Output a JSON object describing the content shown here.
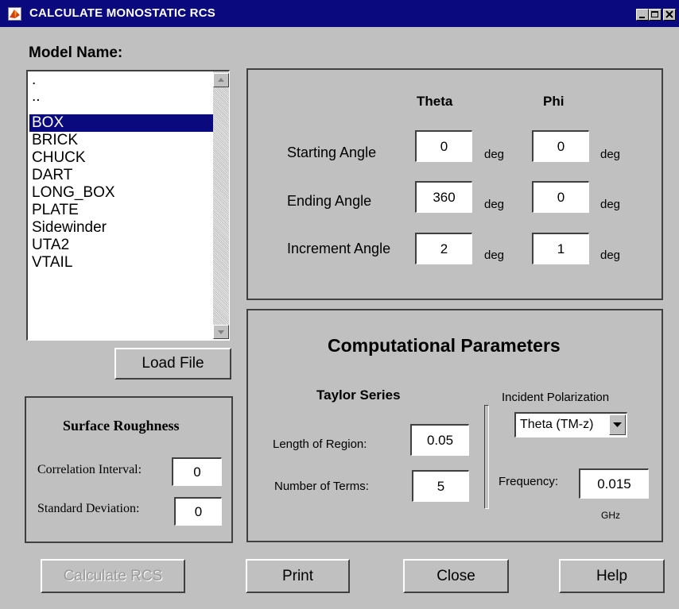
{
  "window": {
    "title": "CALCULATE MONOSTATIC RCS"
  },
  "model": {
    "label": "Model Name:",
    "items": [
      ".",
      "..",
      "BOX",
      "BRICK",
      "CHUCK",
      "DART",
      "LONG_BOX",
      "PLATE",
      "Sidewinder",
      "UTA2",
      "VTAIL"
    ],
    "selected": "BOX",
    "load_button": "Load File"
  },
  "angles": {
    "theta_header": "Theta",
    "phi_header": "Phi",
    "unit": "deg",
    "rows": [
      {
        "label": "Starting Angle",
        "theta": "0",
        "phi": "0"
      },
      {
        "label": "Ending Angle",
        "theta": "360",
        "phi": "0"
      },
      {
        "label": "Increment Angle",
        "theta": "2",
        "phi": "1"
      }
    ]
  },
  "roughness": {
    "title": "Surface Roughness",
    "correlation_label": "Correlation Interval:",
    "correlation_value": "0",
    "deviation_label": "Standard Deviation:",
    "deviation_value": "0"
  },
  "computational": {
    "title": "Computational Parameters",
    "taylor_title": "Taylor Series",
    "length_label": "Length of Region:",
    "length_value": "0.05",
    "terms_label": "Number of Terms:",
    "terms_value": "5",
    "polarization_label": "Incident Polarization",
    "polarization_value": "Theta (TM-z)",
    "frequency_label": "Frequency:",
    "frequency_value": "0.015",
    "frequency_unit": "GHz"
  },
  "buttons": {
    "calculate": "Calculate RCS",
    "print": "Print",
    "close": "Close",
    "help": "Help"
  }
}
